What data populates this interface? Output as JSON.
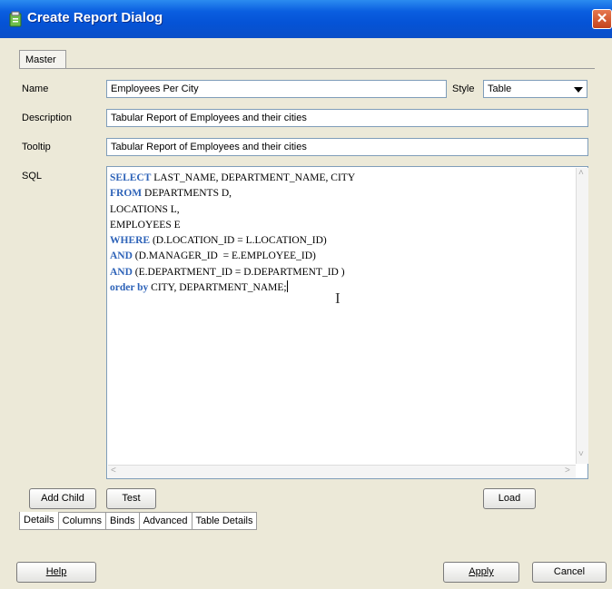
{
  "window": {
    "title": "Create Report Dialog"
  },
  "tabs": {
    "master": "Master"
  },
  "form": {
    "name_label": "Name",
    "name_value": "Employees Per City",
    "style_label": "Style",
    "style_value": "Table",
    "description_label": "Description",
    "description_value": "Tabular Report of Employees and their cities",
    "tooltip_label": "Tooltip",
    "tooltip_value": "Tabular Report of Employees and their cities",
    "sql_label": "SQL"
  },
  "sql": {
    "lines": [
      [
        {
          "k": true,
          "t": "SELECT"
        },
        {
          "k": false,
          "t": " LAST_NAME, DEPARTMENT_NAME, CITY"
        }
      ],
      [
        {
          "k": true,
          "t": "FROM"
        },
        {
          "k": false,
          "t": " DEPARTMENTS D,"
        }
      ],
      [
        {
          "k": false,
          "t": "LOCATIONS L,"
        }
      ],
      [
        {
          "k": false,
          "t": "EMPLOYEES E"
        }
      ],
      [
        {
          "k": true,
          "t": "WHERE"
        },
        {
          "k": false,
          "t": " (D.LOCATION_ID = L.LOCATION_ID)"
        }
      ],
      [
        {
          "k": true,
          "t": "AND"
        },
        {
          "k": false,
          "t": " (D.MANAGER_ID  = E.EMPLOYEE_ID)"
        }
      ],
      [
        {
          "k": true,
          "t": "AND"
        },
        {
          "k": false,
          "t": " (E.DEPARTMENT_ID = D.DEPARTMENT_ID )"
        }
      ],
      [
        {
          "k": true,
          "t": "order by"
        },
        {
          "k": false,
          "t": " CITY, DEPARTMENT_NAME;"
        }
      ]
    ]
  },
  "buttons": {
    "add_child": "Add Child",
    "test": "Test",
    "load": "Load",
    "help": "Help",
    "apply": "Apply",
    "cancel": "Cancel"
  },
  "bottom_tabs": [
    "Details",
    "Columns",
    "Binds",
    "Advanced",
    "Table Details"
  ],
  "active_bottom_tab": "Details",
  "colors": {
    "title_bar": "#0553d6",
    "keyword": "#2e63b8",
    "dialog_bg": "#ece9d8"
  },
  "icons": {
    "title": "report-icon",
    "close": "close-icon"
  }
}
